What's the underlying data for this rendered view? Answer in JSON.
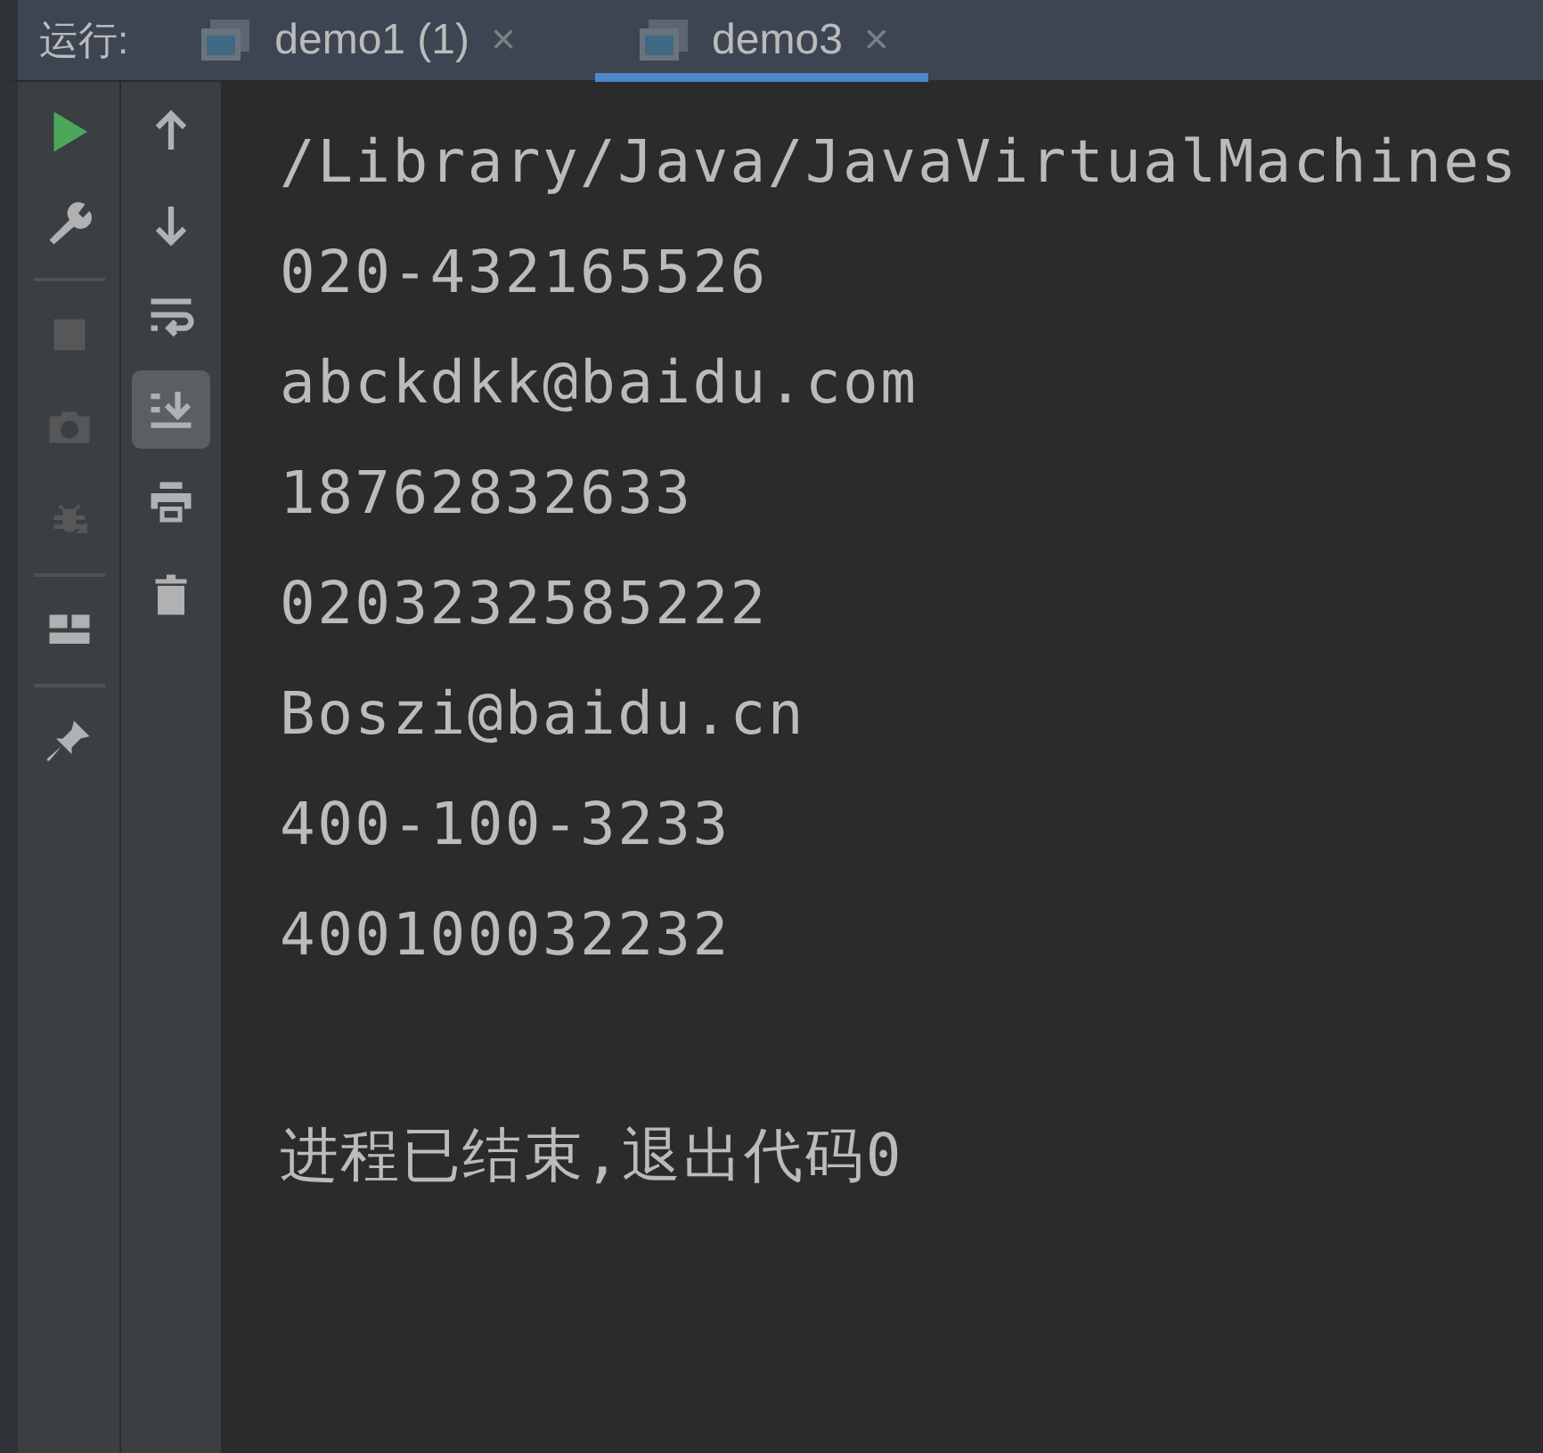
{
  "run_bar": {
    "label": "运行:",
    "tabs": [
      {
        "label": "demo1 (1)",
        "close": "×",
        "selected": false
      },
      {
        "label": "demo3",
        "close": "×",
        "selected": true
      }
    ]
  },
  "left_toolbar": [
    {
      "kind": "run",
      "disabled": false
    },
    {
      "kind": "wrench",
      "disabled": false
    },
    {
      "kind": "separator"
    },
    {
      "kind": "stop",
      "disabled": true
    },
    {
      "kind": "camera",
      "disabled": true
    },
    {
      "kind": "bug",
      "disabled": true
    },
    {
      "kind": "separator"
    },
    {
      "kind": "layout",
      "disabled": false
    },
    {
      "kind": "separator"
    },
    {
      "kind": "pin",
      "disabled": false
    }
  ],
  "right_toolbar": [
    {
      "kind": "up",
      "selected": false
    },
    {
      "kind": "down",
      "selected": false
    },
    {
      "kind": "wrap",
      "selected": false
    },
    {
      "kind": "scroll-end",
      "selected": true
    },
    {
      "kind": "print",
      "selected": false
    },
    {
      "kind": "trash",
      "selected": false
    }
  ],
  "console": {
    "lines": [
      "/Library/Java/JavaVirtualMachines",
      "020-432165526",
      "abckdkk@baidu.com",
      "18762832633",
      "0203232585222",
      "Boszi@baidu.cn",
      "400-100-3233",
      "400100032232"
    ],
    "exit_message": "进程已结束,退出代码0"
  }
}
